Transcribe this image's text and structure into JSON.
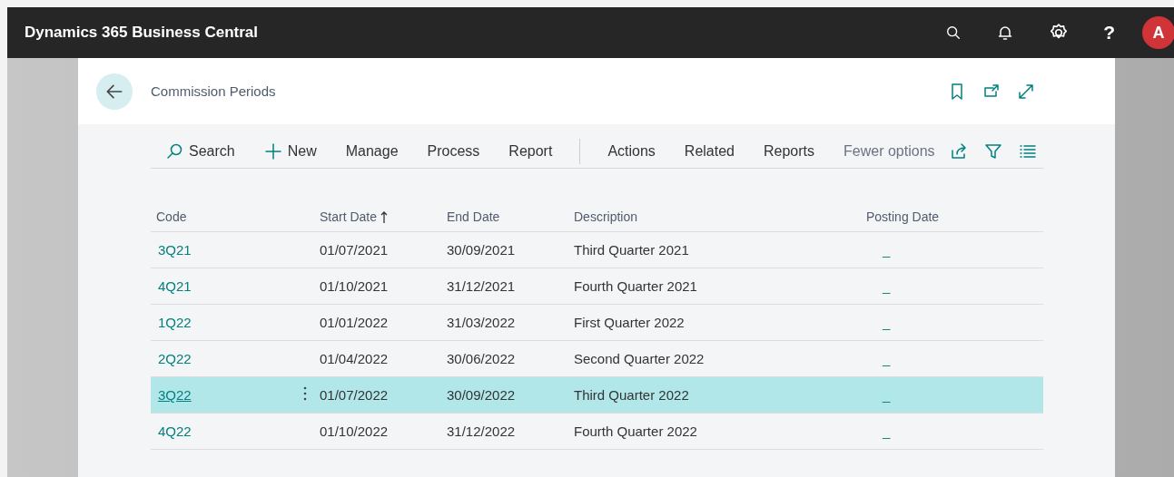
{
  "app_bar": {
    "title": "Dynamics 365 Business Central",
    "help": "?",
    "avatar": "A"
  },
  "dialog": {
    "title": "Commission Periods"
  },
  "toolbar": {
    "primary": [
      {
        "label": "Search",
        "kind": "search"
      },
      {
        "label": "New",
        "kind": "new"
      },
      {
        "label": "Manage",
        "kind": "menu"
      },
      {
        "label": "Process",
        "kind": "menu"
      },
      {
        "label": "Report",
        "kind": "menu"
      }
    ],
    "secondary": [
      {
        "label": "Actions",
        "kind": "menu"
      },
      {
        "label": "Related",
        "kind": "menu"
      },
      {
        "label": "Reports",
        "kind": "menu"
      },
      {
        "label": "Fewer options",
        "kind": "toggle"
      }
    ]
  },
  "table": {
    "columns": [
      {
        "label": "Code",
        "sorted": false
      },
      {
        "label": "Start Date",
        "sorted": true
      },
      {
        "label": "End Date",
        "sorted": false
      },
      {
        "label": "Description",
        "sorted": false
      },
      {
        "label": "Posting Date",
        "sorted": false
      }
    ],
    "rows": [
      {
        "code": "3Q21",
        "start_date": "01/07/2021",
        "end_date": "30/09/2021",
        "description": "Third Quarter 2021",
        "posting_date": "_",
        "selected": false
      },
      {
        "code": "4Q21",
        "start_date": "01/10/2021",
        "end_date": "31/12/2021",
        "description": "Fourth Quarter 2021",
        "posting_date": "_",
        "selected": false
      },
      {
        "code": "1Q22",
        "start_date": "01/01/2022",
        "end_date": "31/03/2022",
        "description": "First Quarter 2022",
        "posting_date": "_",
        "selected": false
      },
      {
        "code": "2Q22",
        "start_date": "01/04/2022",
        "end_date": "30/06/2022",
        "description": "Second Quarter 2022",
        "posting_date": "_",
        "selected": false
      },
      {
        "code": "3Q22",
        "start_date": "01/07/2022",
        "end_date": "30/09/2022",
        "description": "Third Quarter 2022",
        "posting_date": "_",
        "selected": true
      },
      {
        "code": "4Q22",
        "start_date": "01/10/2022",
        "end_date": "31/12/2022",
        "description": "Fourth Quarter 2022",
        "posting_date": "_",
        "selected": false
      }
    ]
  }
}
